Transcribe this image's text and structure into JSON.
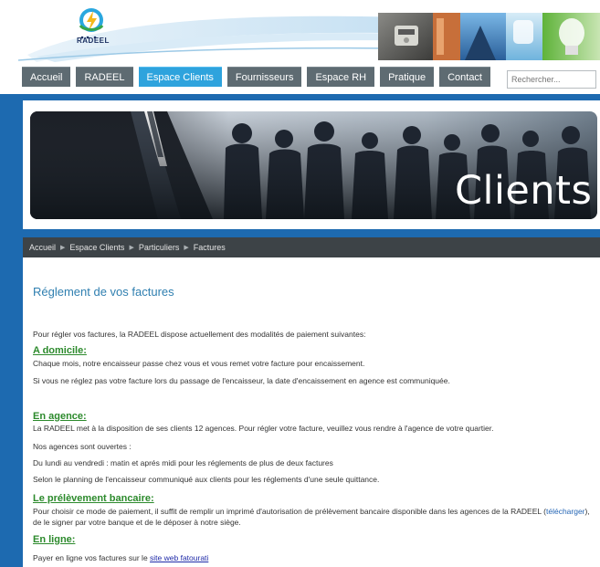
{
  "header": {
    "logo_text": "RADEEL",
    "search_placeholder": "Rechercher..."
  },
  "nav": {
    "items": [
      "Accueil",
      "RADEEL",
      "Espace Clients",
      "Fournisseurs",
      "Espace RH",
      "Pratique",
      "Contact"
    ],
    "active": "Espace Clients"
  },
  "banner": {
    "title": "Clients"
  },
  "breadcrumb": [
    "Accueil",
    "Espace Clients",
    "Particuliers",
    "Factures"
  ],
  "main": {
    "title": "Réglement de vos factures",
    "intro": "Pour régler vos factures, la RADEEL dispose actuellement des modalités de paiement suivantes:",
    "domicile": {
      "heading": "A domicile:",
      "p1": "Chaque mois, notre encaisseur passe chez vous et vous remet votre facture pour encaissement.",
      "p2": "Si vous ne réglez pas votre facture lors du passage de l'encaisseur, la date d'encaissement en agence est communiquée."
    },
    "agence": {
      "heading": "En agence:",
      "p1": "La RADEEL met à la disposition de ses clients 12 agences. Pour régler votre facture, veuillez vous rendre à l'agence de votre quartier.",
      "p2": "Nos agences sont ouvertes :",
      "p3": "Du lundi au vendredi : matin et aprés midi pour les réglements de plus de deux factures",
      "p4": "Selon le planning de l'encaisseur communiqué aux clients pour les réglements d'une seule quittance."
    },
    "prelevement": {
      "heading": "Le prélèvement bancaire:",
      "p1_before": "Pour choisir ce mode de paiement, il suffit de remplir un imprimé d'autorisation de prélèvement bancaire disponible dans les agences de la RADEEL (",
      "p1_link": "télécharger",
      "p1_after": "),",
      "p2": "de le signer par votre banque et de le déposer à notre siège."
    },
    "enligne": {
      "heading": "En ligne:",
      "p1_before": "Payer en ligne vos factures sur le ",
      "p1_link": "site web fatourati"
    }
  }
}
